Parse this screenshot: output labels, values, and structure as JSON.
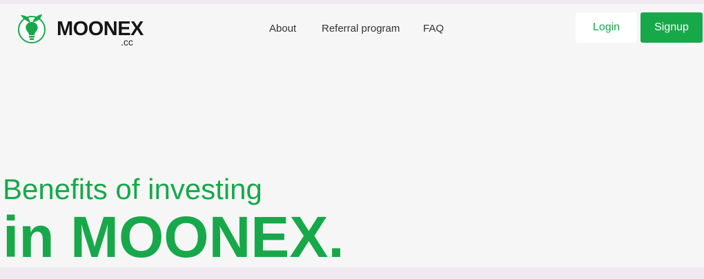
{
  "brand": {
    "name": "MOONEX",
    "suffix": ".cc",
    "logo_icon": "lightbulb-leaf-icon",
    "accent_color": "#17a84a"
  },
  "nav": {
    "items": [
      {
        "label": "About"
      },
      {
        "label": "Referral program"
      },
      {
        "label": "FAQ"
      }
    ]
  },
  "auth": {
    "login_label": "Login",
    "signup_label": "Signup"
  },
  "hero": {
    "subtitle": "Benefits of investing",
    "title": "in MOONEX."
  }
}
